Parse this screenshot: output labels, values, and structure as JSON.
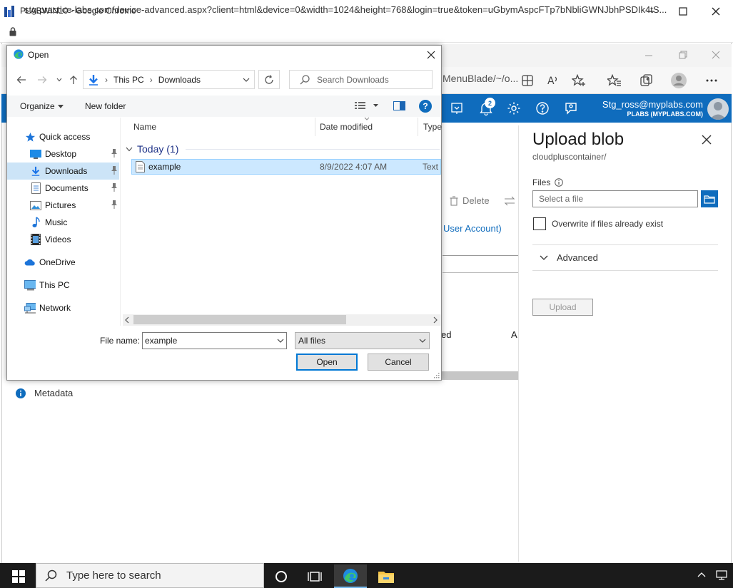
{
  "chrome": {
    "title": "PLABWIN10 - Google Chrome",
    "url": "stg.practice-labs.com/device-advanced.aspx?client=html&device=0&width=1024&height=768&login=true&token=uGbymAspcFTp7bNbliGWNJbhPSDIk4tS..."
  },
  "edge": {
    "address_fragment": "MenuBlade/~/o..."
  },
  "azure": {
    "notification_count": "2",
    "user_email": "Stg_ross@myplabs.com",
    "user_org": "PLABS (MYPLABS.COM)",
    "background": {
      "delete_label": "Delete",
      "user_account": "User Account)",
      "col_fragment_ed": "ed",
      "col_fragment_a": "A",
      "metadata_label": "Metadata"
    },
    "upload_panel": {
      "title": "Upload blob",
      "subtitle": "cloudpluscontainer/",
      "files_label": "Files",
      "file_placeholder": "Select a file",
      "overwrite_label": "Overwrite if files already exist",
      "advanced_label": "Advanced",
      "upload_button": "Upload"
    }
  },
  "dialog": {
    "title": "Open",
    "breadcrumb": [
      "This PC",
      "Downloads"
    ],
    "search_placeholder": "Search Downloads",
    "organize_label": "Organize",
    "new_folder_label": "New folder",
    "nav_items": [
      {
        "label": "Quick access"
      },
      {
        "label": "Desktop"
      },
      {
        "label": "Downloads"
      },
      {
        "label": "Documents"
      },
      {
        "label": "Pictures"
      },
      {
        "label": "Music"
      },
      {
        "label": "Videos"
      },
      {
        "label": "OneDrive"
      },
      {
        "label": "This PC"
      },
      {
        "label": "Network"
      }
    ],
    "columns": {
      "name": "Name",
      "date": "Date modified",
      "type": "Type"
    },
    "group_label": "Today (1)",
    "files": [
      {
        "name": "example",
        "date": "8/9/2022 4:07 AM",
        "type": "Text Document"
      }
    ],
    "file_name_label": "File name:",
    "file_name_value": "example",
    "filter_value": "All files",
    "open_button": "Open",
    "cancel_button": "Cancel"
  },
  "taskbar": {
    "search_placeholder": "Type here to search"
  },
  "colors": {
    "azure_blue": "#0f6cbd",
    "selection": "#cce8ff",
    "taskbar": "#1b1b1b"
  }
}
